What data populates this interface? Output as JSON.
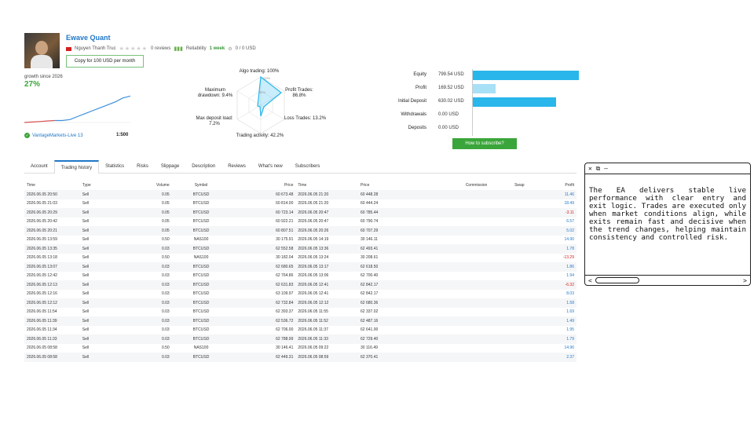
{
  "profile": {
    "title": "Ewave Quant",
    "author": "Nguyen Thanh Truc",
    "reviews": "0 reviews",
    "reliability_label": "Reliability",
    "weeks": "1 week",
    "subscribers_stat": "0 / 0 USD",
    "copy_button": "Copy for 100 USD per month"
  },
  "growth": {
    "label": "growth since 2026",
    "value": "27%",
    "broker": "VantageMarkets-Live 13",
    "leverage": "1:500"
  },
  "radar": {
    "algo": "Algo trading: 100%",
    "algo_axis": "100%",
    "mid_axis": "50%",
    "profit_trades": "Profit Trades:",
    "profit_trades_val": "86.8%",
    "loss_trades": "Loss Trades: 13.2%",
    "activity": "Trading activity: 42.2%",
    "max_deposit": "Max deposit load:",
    "max_deposit_val": "7.2%",
    "max_drawdown": "Maximum",
    "max_drawdown2": "drawdown: 9.4%"
  },
  "balance": {
    "rows": [
      {
        "label": "Equity",
        "value": "799.54 USD",
        "fraction": 1.0
      },
      {
        "label": "Profit",
        "value": "169.52 USD",
        "fraction": 0.212
      },
      {
        "label": "Initial Deposit",
        "value": "630.02 USD",
        "fraction": 0.788
      },
      {
        "label": "Withdrawals",
        "value": "0.00 USD",
        "fraction": 0
      },
      {
        "label": "Deposits",
        "value": "0.00 USD",
        "fraction": 0
      }
    ],
    "subscribe_button": "How to subscribe?",
    "bar_color": "#29b6ea"
  },
  "tabs": [
    "Account",
    "Trading history",
    "Statistics",
    "Risks",
    "Slippage",
    "Description",
    "Reviews",
    "What's new",
    "Subscribers"
  ],
  "table": {
    "headers": [
      "Time",
      "Type",
      "Volume",
      "Symbol",
      "Price",
      "Time",
      "Price",
      "Commission",
      "Swap",
      "Profit"
    ],
    "rows": [
      [
        "2026.06.05 20:50",
        "Sell",
        "0.05",
        "BTCUSD",
        "60 673.48",
        "2026.06.05 21:20",
        "60 448.28",
        "",
        "",
        "11.46"
      ],
      [
        "2026.06.05 21:03",
        "Sell",
        "0.05",
        "BTCUSD",
        "60 814.00",
        "2026.06.05 21:20",
        "60 444.24",
        "",
        "",
        "18.49"
      ],
      [
        "2026.06.05 20:29",
        "Sell",
        "0.05",
        "BTCUSD",
        "60 723.14",
        "2026.06.05 20:47",
        "60 785.44",
        "",
        "",
        "-3.11"
      ],
      [
        "2026.06.05 20:42",
        "Sell",
        "0.05",
        "BTCUSD",
        "60 922.21",
        "2026.06.05 20:47",
        "60 790.74",
        "",
        "",
        "6.57"
      ],
      [
        "2026.06.05 20:21",
        "Sell",
        "0.05",
        "BTCUSD",
        "60 807.51",
        "2026.06.05 20:26",
        "60 707.29",
        "",
        "",
        "5.02"
      ],
      [
        "2026.06.05 13:59",
        "Sell",
        "0.50",
        "NAS100",
        "30 175.91",
        "2026.06.05 14:19",
        "30 146.11",
        "",
        "",
        "14.90"
      ],
      [
        "2026.06.05 13:35",
        "Sell",
        "0.03",
        "BTCUSD",
        "62 552.58",
        "2026.06.05 13:36",
        "62 493.41",
        "",
        "",
        "1.78"
      ],
      [
        "2026.06.05 13:18",
        "Sell",
        "0.50",
        "NAS100",
        "30 182.04",
        "2026.06.05 13:24",
        "30 208.61",
        "",
        "",
        "-13.29"
      ],
      [
        "2026.06.05 13:07",
        "Sell",
        "0.03",
        "BTCUSD",
        "62 680.65",
        "2026.06.05 13:17",
        "62 618.50",
        "",
        "",
        "1.86"
      ],
      [
        "2026.06.05 12:42",
        "Sell",
        "0.03",
        "BTCUSD",
        "62 764.86",
        "2026.06.05 13:06",
        "62 700.40",
        "",
        "",
        "1.94"
      ],
      [
        "2026.06.05 12:13",
        "Sell",
        "0.03",
        "BTCUSD",
        "62 631.83",
        "2026.06.05 12:41",
        "62 842.17",
        "",
        "",
        "-6.32"
      ],
      [
        "2026.06.05 12:16",
        "Sell",
        "0.03",
        "BTCUSD",
        "63 109.97",
        "2026.06.05 12:41",
        "62 842.17",
        "",
        "",
        "8.03"
      ],
      [
        "2026.06.05 12:12",
        "Sell",
        "0.03",
        "BTCUSD",
        "62 732.84",
        "2026.06.05 12:12",
        "62 680.36",
        "",
        "",
        "1.58"
      ],
      [
        "2026.06.05 11:54",
        "Sell",
        "0.03",
        "BTCUSD",
        "62 393.37",
        "2026.06.05 11:55",
        "62 337.02",
        "",
        "",
        "1.69"
      ],
      [
        "2026.06.05 11:39",
        "Sell",
        "0.03",
        "BTCUSD",
        "62 536.72",
        "2026.06.05 11:52",
        "62 487.16",
        "",
        "",
        "1.49"
      ],
      [
        "2026.06.05 11:34",
        "Sell",
        "0.03",
        "BTCUSD",
        "62 706.00",
        "2026.06.05 11:37",
        "62 641.00",
        "",
        "",
        "1.95"
      ],
      [
        "2026.06.05 11:33",
        "Sell",
        "0.03",
        "BTCUSD",
        "62 788.99",
        "2026.06.05 11:33",
        "62 729.40",
        "",
        "",
        "1.79"
      ],
      [
        "2026.06.05 08:58",
        "Sell",
        "0.50",
        "NAS100",
        "30 146.41",
        "2026.06.05 09:22",
        "30 116.49",
        "",
        "",
        "14.96"
      ],
      [
        "2026.06.05 08:58",
        "Sell",
        "0.03",
        "BTCUSD",
        "62 449.31",
        "2026.06.05 08:59",
        "62 370.41",
        "",
        "",
        "2.37"
      ]
    ]
  },
  "note_card": {
    "top_icons": "✕ ⧉ —",
    "text": "The EA delivers stable live performance with clear entry and exit logic. Trades are executed only when market conditions align, while exits remain fast and decisive when the trend changes, helping maintain consistency and controlled risk.",
    "left_arrow": "<",
    "right_arrow": ">"
  },
  "growth_curve": [
    0,
    0.5,
    1,
    1.5,
    2,
    2,
    3,
    6,
    9,
    12,
    15,
    18,
    21,
    25,
    27
  ],
  "colors": {
    "accent": "#1f77c9",
    "green": "#3aa53a",
    "negative": "#d32020"
  }
}
